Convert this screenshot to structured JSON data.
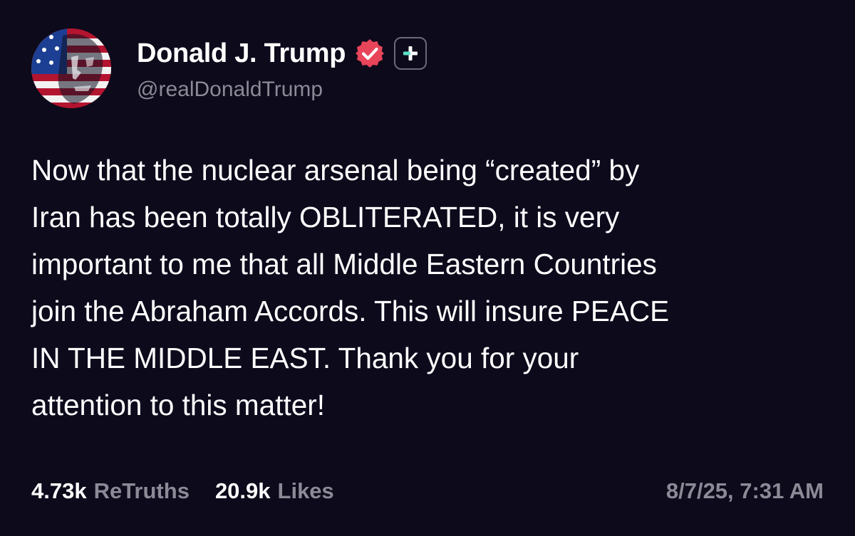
{
  "colors": {
    "background": "#0c0a1b",
    "text": "#ffffff",
    "muted": "#8b8a96",
    "verified_badge": "#e8445a",
    "plus_accent": "#5ee0c8"
  },
  "author": {
    "display_name": "Donald J. Trump",
    "handle": "@realDonaldTrump",
    "avatar_icon": "flag-portrait-avatar",
    "verified_icon": "verified-check-icon",
    "plus_icon": "plus-icon"
  },
  "post": {
    "lines": [
      "Now that the nuclear arsenal being “created” by",
      "Iran has been totally OBLITERATED, it is very",
      "important to me that all Middle Eastern Countries",
      "join the Abraham Accords. This will insure PEACE",
      "IN THE MIDDLE EAST. Thank you for your",
      "attention to this matter!"
    ]
  },
  "stats": {
    "retruths_count": "4.73k",
    "retruths_label": "ReTruths",
    "likes_count": "20.9k",
    "likes_label": "Likes",
    "timestamp": "8/7/25, 7:31 AM"
  }
}
